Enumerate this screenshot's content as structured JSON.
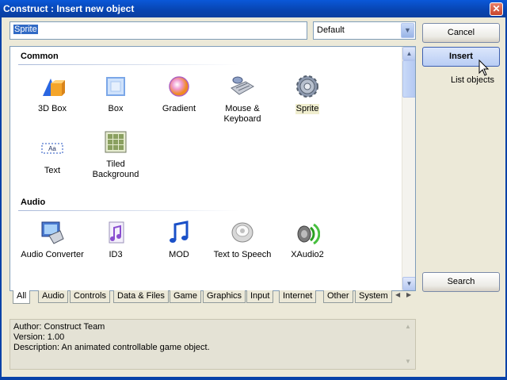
{
  "window": {
    "title": "Construct : Insert new object",
    "close_glyph": "✕"
  },
  "search": {
    "value": "Sprite"
  },
  "filter": {
    "selected": "Default"
  },
  "sections": [
    {
      "name": "Common",
      "items": [
        {
          "label": "3D Box",
          "icon": "3d-box-icon"
        },
        {
          "label": "Box",
          "icon": "box-icon"
        },
        {
          "label": "Gradient",
          "icon": "gradient-icon"
        },
        {
          "label": "Mouse &",
          "label2": "Keyboard",
          "icon": "mouse-keyboard-icon"
        },
        {
          "label": "Sprite",
          "icon": "sprite-icon",
          "selected": true
        },
        {
          "label": "Text",
          "icon": "text-icon",
          "badge": "Aa"
        },
        {
          "label": "Tiled",
          "label2": "Background",
          "icon": "tiled-background-icon"
        }
      ]
    },
    {
      "name": "Audio",
      "items": [
        {
          "label": "Audio Converter",
          "icon": "audio-converter-icon"
        },
        {
          "label": "ID3",
          "icon": "id3-icon"
        },
        {
          "label": "MOD",
          "icon": "mod-icon"
        },
        {
          "label": "Text to Speech",
          "icon": "text-to-speech-icon"
        },
        {
          "label": "XAudio2",
          "icon": "xaudio2-icon"
        }
      ]
    }
  ],
  "tabs": [
    "All",
    "Audio",
    "Controls",
    "Data & Files",
    "Game",
    "Graphics",
    "Input",
    "Internet",
    "Other",
    "System"
  ],
  "active_tab": "All",
  "info": {
    "author": "Author: Construct Team",
    "version": "Version: 1.00",
    "description": "Description: An animated controllable game object."
  },
  "buttons": {
    "cancel": "Cancel",
    "insert": "Insert",
    "list_objects": "List objects",
    "search": "Search"
  },
  "colors": {
    "title_bar": "#0a4fd0",
    "selection": "#316ac5",
    "dialog_bg": "#ece9d8"
  }
}
